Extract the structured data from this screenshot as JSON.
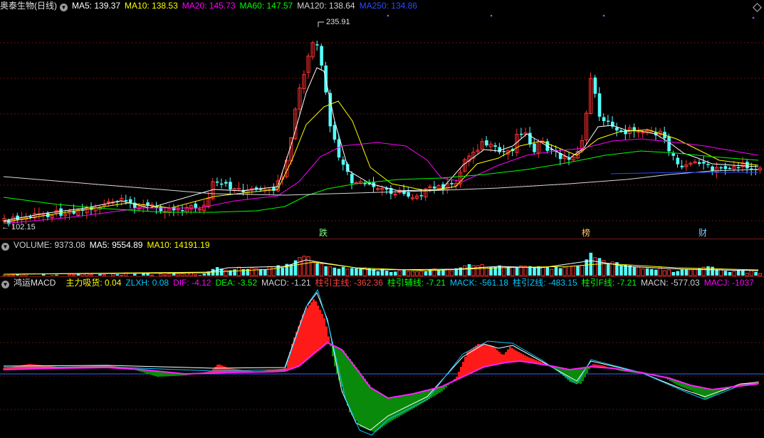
{
  "price_panel": {
    "name": "奥泰生物(日线)",
    "ma": [
      {
        "label": "MA5: 139.37",
        "color": "#ffffff"
      },
      {
        "label": "MA10: 138.53",
        "color": "#ffff00"
      },
      {
        "label": "MA20: 145.73",
        "color": "#ff00ff"
      },
      {
        "label": "MA60: 147.57",
        "color": "#00ff00"
      },
      {
        "label": "MA120: 138.64",
        "color": "#d0d0d0"
      },
      {
        "label": "MA250: 134.86",
        "color": "#2a4dff"
      }
    ],
    "high_label": "235.91",
    "low_label": "102.15",
    "markers": [
      {
        "text": "跌",
        "color": "#7fff7f"
      },
      {
        "text": "榜",
        "color": "#ffcc66"
      },
      {
        "text": "财",
        "color": "#7fc8ff"
      }
    ]
  },
  "volume_panel": {
    "labels": [
      {
        "label": "VOLUME: 9373.08",
        "color": "#d0d0d0"
      },
      {
        "label": "MA5: 9554.89",
        "color": "#ffffff"
      },
      {
        "label": "MA10: 14191.19",
        "color": "#ffff00"
      }
    ]
  },
  "macd_panel": {
    "name": "鸿运MACD",
    "labels": [
      {
        "label": "主力吸货: 0.04",
        "color": "#ffff00"
      },
      {
        "label": "ZLXH: 0.08",
        "color": "#00c8ff"
      },
      {
        "label": "DIF: -4.12",
        "color": "#ff00ff"
      },
      {
        "label": "DEA: -3.52",
        "color": "#00ff00"
      },
      {
        "label": "MACD: -1.21",
        "color": "#d0d0d0"
      },
      {
        "label": "柱引主线: -362.36",
        "color": "#ff4040"
      },
      {
        "label": "柱引辅线: -7.21",
        "color": "#00ff00"
      },
      {
        "label": "MACK: -561.18",
        "color": "#00c8ff"
      },
      {
        "label": "柱引Z线: -483.15",
        "color": "#00c8ff"
      },
      {
        "label": "柱引F线: -7.21",
        "color": "#00ff00"
      },
      {
        "label": "MACN: -577.03",
        "color": "#d0d0d0"
      },
      {
        "label": "MACJ: -1037",
        "color": "#ff00ff"
      }
    ]
  },
  "chart_data": [
    {
      "type": "candlestick",
      "title": "奥泰生物(日线)",
      "y_high": 235.91,
      "y_low": 102.15,
      "ma_periods": [
        5,
        10,
        20,
        60,
        120,
        250
      ]
    },
    {
      "type": "bar",
      "title": "VOLUME",
      "series": [
        {
          "name": "VOLUME"
        },
        {
          "name": "MA5"
        },
        {
          "name": "MA10"
        }
      ]
    },
    {
      "type": "line",
      "title": "鸿运MACD",
      "series": [
        {
          "name": "DIF"
        },
        {
          "name": "DEA"
        },
        {
          "name": "MACD"
        }
      ]
    }
  ]
}
